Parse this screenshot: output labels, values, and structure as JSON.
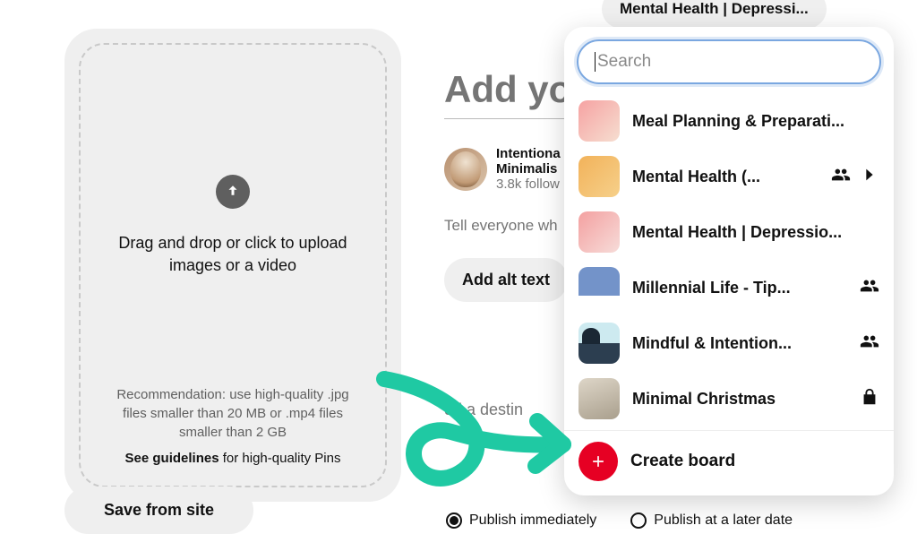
{
  "top_pill_label": "Mental Health | Depressi...",
  "upload": {
    "prompt": "Drag and drop or click to upload images or a video",
    "recommendation": "Recommendation: use high-quality .jpg files smaller than 20 MB or .mp4 files smaller than 2 GB",
    "guidelines_bold": "See guidelines",
    "guidelines_rest": " for high-quality Pins"
  },
  "form": {
    "title_placeholder": "Add you",
    "profile_name": "Intentiona",
    "profile_sub": "Minimalis",
    "followers": "3.8k follow",
    "description_placeholder": "Tell everyone wh",
    "alt_text_button": "Add alt text",
    "destination_placeholder": "dd a destin"
  },
  "boards": {
    "search_placeholder": "Search",
    "items": [
      {
        "label": "Meal Planning & Preparati...",
        "group": false,
        "chevron": false,
        "lock": false
      },
      {
        "label": "Mental Health (...",
        "group": true,
        "chevron": true,
        "lock": false
      },
      {
        "label": "Mental Health | Depressio...",
        "group": false,
        "chevron": false,
        "lock": false
      },
      {
        "label": "Millennial Life - Tip...",
        "group": true,
        "chevron": false,
        "lock": false
      },
      {
        "label": "Mindful & Intention...",
        "group": true,
        "chevron": false,
        "lock": false
      },
      {
        "label": "Minimal Christmas",
        "group": false,
        "chevron": false,
        "lock": true
      }
    ],
    "create_label": "Create board"
  },
  "bottom": {
    "save_from_site": "Save from site",
    "publish_now": "Publish immediately",
    "publish_later": "Publish at a later date"
  }
}
